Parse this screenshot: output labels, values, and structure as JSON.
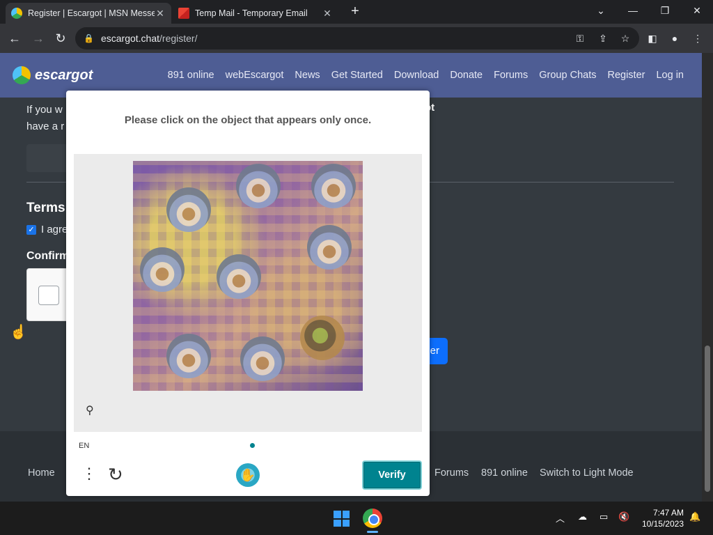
{
  "browser": {
    "tabs": [
      {
        "title": "Register | Escargot | MSN Messe",
        "active": true,
        "icon": "escargot-favicon"
      },
      {
        "title": "Temp Mail - Temporary Email",
        "active": false,
        "icon": "gmail-favicon"
      }
    ],
    "url_host": "escargot.chat",
    "url_path": "/register/"
  },
  "site": {
    "brand": "escargot",
    "nav": [
      "891 online",
      "webEscargot",
      "News",
      "Get Started",
      "Download",
      "Donate",
      "Forums",
      "Group Chats",
      "Register",
      "Log in"
    ],
    "intro_line1": "If you w",
    "intro_line1_end": "ot",
    "intro_line2": "have a r",
    "terms_heading": "Terms",
    "agree_label": "I agre",
    "confirm_heading": "Confirm",
    "register_button": "er",
    "footer_links": [
      "Home",
      "Forums",
      "891 online",
      "Switch to Light Mode"
    ]
  },
  "captcha": {
    "prompt": "Please click on the object that appears only once.",
    "language": "EN",
    "verify_label": "Verify"
  },
  "taskbar": {
    "time": "7:47 AM",
    "date": "10/15/2023"
  },
  "colors": {
    "nav_bg": "#4e5d94",
    "page_bg": "#343a40",
    "verify_bg": "#00838f",
    "register_bg": "#0d6efd"
  }
}
